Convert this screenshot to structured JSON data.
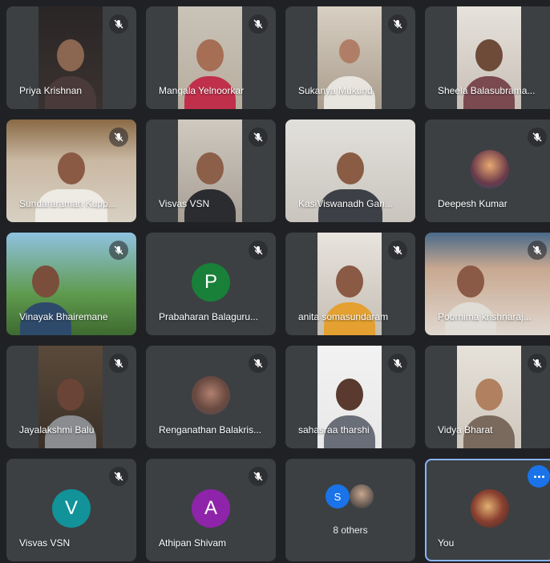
{
  "participants": [
    {
      "name": "Priya Krishnan",
      "muted": true,
      "video": true
    },
    {
      "name": "Mangala Yelnoorkar",
      "muted": true,
      "video": true
    },
    {
      "name": "Sukanya Mukund",
      "muted": true,
      "video": true
    },
    {
      "name": "Sheela Balasubrama...",
      "muted": false,
      "video": true
    },
    {
      "name": "Sundararaman Kupp...",
      "muted": true,
      "video": true
    },
    {
      "name": "Visvas VSN",
      "muted": true,
      "video": true
    },
    {
      "name": "KasiViswanadh Gan...",
      "muted": false,
      "video": true
    },
    {
      "name": "Deepesh Kumar",
      "muted": true,
      "video": false
    },
    {
      "name": "Vinayak Bhairemane",
      "muted": true,
      "video": true
    },
    {
      "name": "Prabaharan Balaguru...",
      "muted": true,
      "video": false,
      "initial": "P",
      "color": "#188038"
    },
    {
      "name": "anita somasundaram",
      "muted": true,
      "video": true
    },
    {
      "name": "Poornima krishnaraj...",
      "muted": true,
      "video": true
    },
    {
      "name": "Jayalakshmi Balu",
      "muted": true,
      "video": true
    },
    {
      "name": "Renganathan Balakris...",
      "muted": true,
      "video": false
    },
    {
      "name": "sahasraa tharshi",
      "muted": true,
      "video": true
    },
    {
      "name": "Vidya Bharat",
      "muted": true,
      "video": true
    },
    {
      "name": "Visvas VSN",
      "muted": true,
      "video": false,
      "initial": "V",
      "color": "#12939a"
    },
    {
      "name": "Athipan Shivam",
      "muted": true,
      "video": false,
      "initial": "A",
      "color": "#8e24aa"
    }
  ],
  "others": {
    "label": "8 others",
    "initials": [
      "S"
    ],
    "color": "#1a73e8"
  },
  "self": {
    "name": "You"
  },
  "colors": {
    "background": "#202124",
    "tile": "#3c4043",
    "accent": "#1a73e8"
  }
}
